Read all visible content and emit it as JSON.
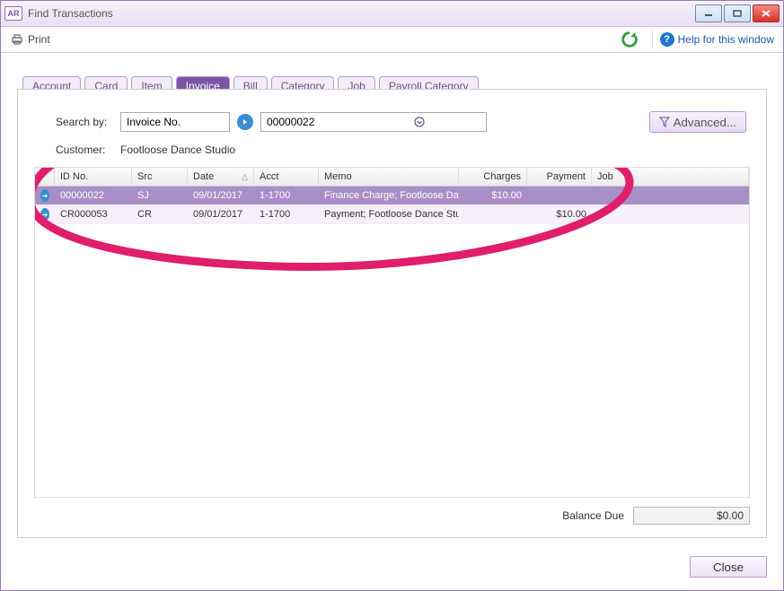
{
  "window": {
    "app_icon": "AR",
    "title": "Find Transactions"
  },
  "toolbar": {
    "print": "Print",
    "help": "Help for this window"
  },
  "tabs": [
    {
      "label": "Account"
    },
    {
      "label": "Card"
    },
    {
      "label": "Item"
    },
    {
      "label": "Invoice"
    },
    {
      "label": "Bill"
    },
    {
      "label": "Category"
    },
    {
      "label": "Job"
    },
    {
      "label": "Payroll Category"
    }
  ],
  "search": {
    "label": "Search by:",
    "by_value": "Invoice No.",
    "value": "00000022",
    "customer_label": "Customer:",
    "customer": "Footloose Dance Studio",
    "advanced": "Advanced..."
  },
  "columns": {
    "id": "ID No.",
    "src": "Src",
    "date": "Date",
    "acct": "Acct",
    "memo": "Memo",
    "charges": "Charges",
    "payment": "Payment",
    "job": "Job"
  },
  "rows": [
    {
      "id": "00000022",
      "src": "SJ",
      "date": "09/01/2017",
      "acct": "1-1700",
      "memo": "Finance Charge; Footloose Dance Studio",
      "charges": "$10.00",
      "payment": "",
      "job": ""
    },
    {
      "id": "CR000053",
      "src": "CR",
      "date": "09/01/2017",
      "acct": "1-1700",
      "memo": "Payment; Footloose Dance Studio",
      "charges": "",
      "payment": "$10.00",
      "job": ""
    }
  ],
  "balance": {
    "label": "Balance Due",
    "value": "$0.00"
  },
  "footer": {
    "close": "Close"
  }
}
